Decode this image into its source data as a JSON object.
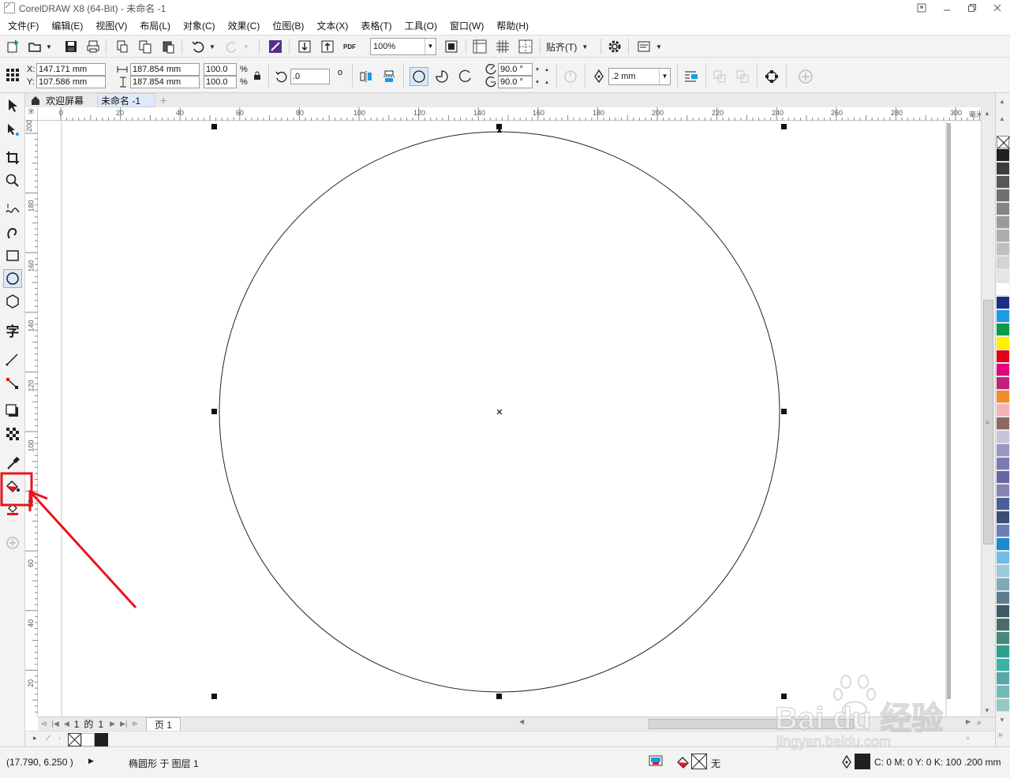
{
  "window": {
    "title": "CorelDRAW X8 (64-Bit) - 未命名 -1",
    "controls": [
      "minimize",
      "restore",
      "close"
    ]
  },
  "menu": [
    "文件(F)",
    "编辑(E)",
    "视图(V)",
    "布局(L)",
    "对象(C)",
    "效果(C)",
    "位图(B)",
    "文本(X)",
    "表格(T)",
    "工具(O)",
    "窗口(W)",
    "帮助(H)"
  ],
  "toolbar": {
    "zoom": "100%",
    "snap_label": "贴齐(T)",
    "pdf_label": "PDF"
  },
  "property_bar": {
    "x_label": "X:",
    "x": "147.171 mm",
    "y_label": "Y:",
    "y": "107.586 mm",
    "width": "187.854 mm",
    "height": "187.854 mm",
    "scale_w": "100.0",
    "scale_h": "100.0",
    "percent": "%",
    "rotation": ".0",
    "degree_symbol": "o",
    "start_angle": "90.0 °",
    "end_angle": "90.0 °",
    "outline_width": ".2 mm"
  },
  "tabs": {
    "welcome": "欢迎屏幕",
    "document": "未命名 -1"
  },
  "ruler": {
    "corner": "米",
    "h_ticks": [
      "0",
      "20",
      "40",
      "60",
      "80",
      "100",
      "120",
      "140",
      "160",
      "180",
      "200",
      "220",
      "240",
      "260",
      "280",
      "300"
    ],
    "h_unit": "毫米",
    "v_ticks": [
      "200",
      "180",
      "160",
      "140",
      "120",
      "100",
      "80",
      "60",
      "40",
      "20"
    ]
  },
  "page_nav": {
    "current": "1",
    "of_label": "的",
    "total": "1",
    "page_tab": "页 1"
  },
  "status": {
    "cursor": "(17.790, 6.250 )",
    "object_info": "椭圆形 于 图层 1",
    "fill_label": "无",
    "outline_info": "C: 0 M: 0 Y: 0 K: 100  .200 mm"
  },
  "palette": {
    "colors": [
      "#231f20",
      "#3d3d3d",
      "#575757",
      "#6f6f6f",
      "#858585",
      "#9b9b9b",
      "#adadad",
      "#bfbfbf",
      "#d3d3d3",
      "#e5e5e5",
      "#ffffff",
      "#1c2d86",
      "#1a9be6",
      "#0a9b48",
      "#fff200",
      "#e2001a",
      "#e4007e",
      "#c2207a",
      "#f28c28",
      "#f4b4b4",
      "#8c6a5e",
      "#c9c4dc",
      "#9b96c6",
      "#7c7ab5",
      "#6466a8",
      "#8784b3",
      "#4a5f9a",
      "#3d4d7a",
      "#6b7fb4",
      "#1a8ad0",
      "#6fbde6",
      "#9cc9dc",
      "#80a9b4",
      "#5c7e8c",
      "#3d5a66",
      "#4a6b6a",
      "#45897f",
      "#2f9f8f",
      "#3ab3a4",
      "#59a7a8",
      "#73b9b6",
      "#93c9c2"
    ],
    "accent_red": "#e8141c"
  },
  "watermark": {
    "brand": "Bai du 经验",
    "url": "jingyan.baidu.com"
  }
}
